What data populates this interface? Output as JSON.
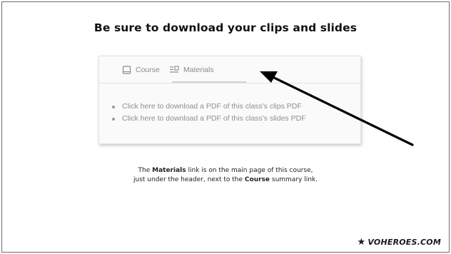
{
  "slide": {
    "title": "Be sure to download your clips and slides"
  },
  "screenshot": {
    "tabs": [
      {
        "label": "Course",
        "icon": "book-icon"
      },
      {
        "label": "Materials",
        "icon": "materials-list-icon",
        "active": true
      }
    ],
    "links": [
      "Click here to download a PDF of this class's clips PDF",
      "Click here to download a PDF of this class's slides PDF"
    ]
  },
  "caption": {
    "line1_pre": "The ",
    "line1_bold": "Materials",
    "line1_post": " link is on the main page of this course,",
    "line2_pre": "just under the header, next to the ",
    "line2_bold": "Course",
    "line2_post": " summary link."
  },
  "logo": {
    "star": "★",
    "text": "VOHEROES.COM"
  },
  "colors": {
    "arrow": "#000000",
    "frame": "#6e6e6e",
    "muted_text": "#8a8a8a"
  }
}
